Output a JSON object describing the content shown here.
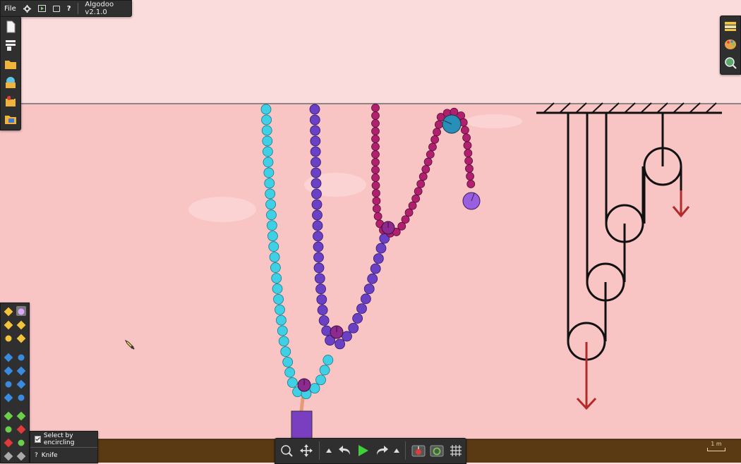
{
  "app": {
    "title": "Algodoo v2.1.0",
    "menu_file": "File",
    "menu_help": "?"
  },
  "tooltip": {
    "option_label": "Select by encircling",
    "tool_name": "Knife",
    "help_mark": "?"
  },
  "scale": {
    "label": "1 m"
  },
  "colors": {
    "sky": "#fbdcdc",
    "water": "#f9c4c4",
    "ground": "#5a3a12",
    "chain_cyan": "#3fd0e6",
    "chain_violet": "#6a40c4",
    "chain_magenta": "#b0206e",
    "pulley_rope": "#111111",
    "force_arrow": "#b22a2a",
    "box_purple": "#7a3ec0",
    "ui_panel": "#2f2f2f"
  },
  "left_toolbar": [
    "new-scene-icon",
    "blank-scene-icon",
    "open-folder-icon",
    "scene-browser-icon",
    "algobox-icon",
    "save-folder-icon"
  ],
  "right_toolbar": [
    "layers-icon",
    "palette-icon",
    "visualization-icon"
  ],
  "bottom_toolbar": [
    "zoom-icon",
    "pan-icon",
    "undo-dropdown-icon",
    "undo-icon",
    "play-icon",
    "redo-icon",
    "redo-dropdown-icon",
    "gravity-icon",
    "air-friction-icon",
    "grid-icon"
  ]
}
